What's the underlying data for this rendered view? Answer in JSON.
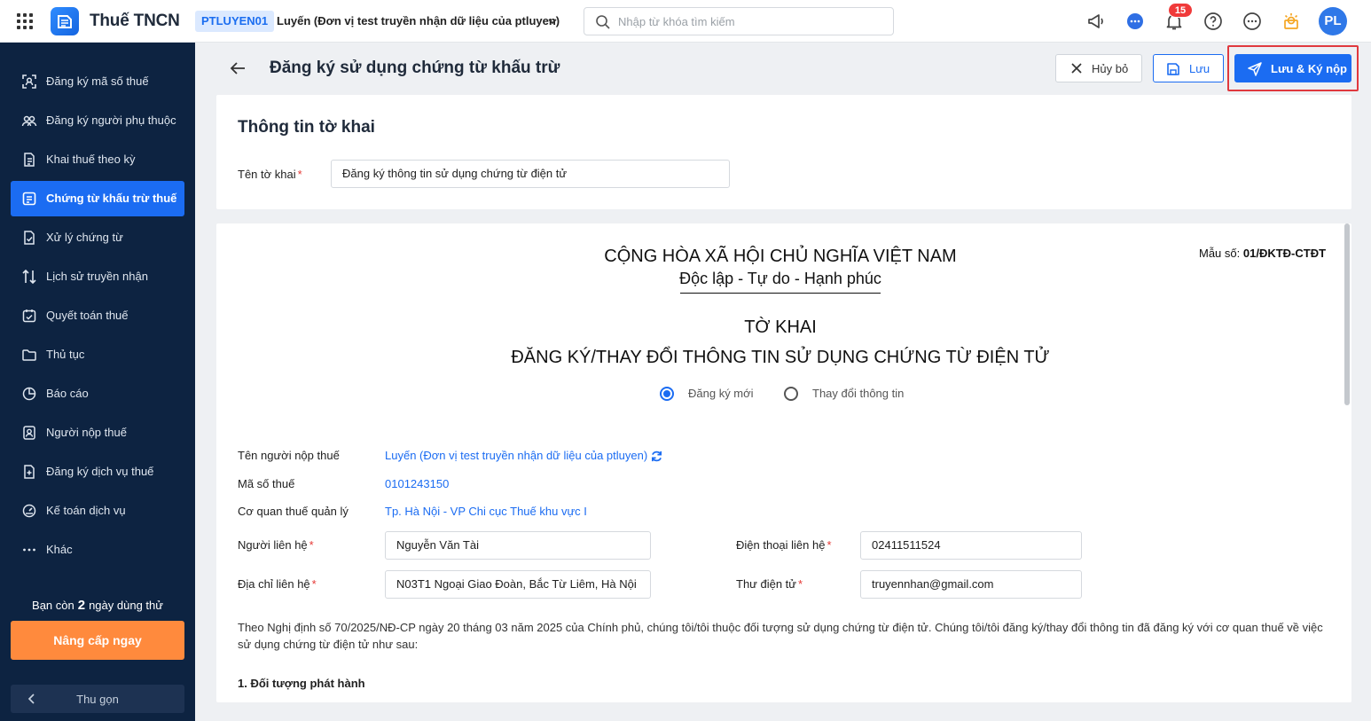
{
  "topbar": {
    "app_name": "Thuế TNCN",
    "unit_code": "PTLUYEN01",
    "unit_name": "Luyến (Đơn vị test truyền nhận dữ liệu của ptluyen)",
    "search_placeholder": "Nhập từ khóa tìm kiếm",
    "notification_count": "15",
    "avatar_initials": "PL"
  },
  "sidebar": {
    "items": [
      {
        "label": "Đăng ký mã số thuế",
        "icon": "scan-user-icon",
        "active": false
      },
      {
        "label": "Đăng ký người phụ thuộc",
        "icon": "users-icon",
        "active": false
      },
      {
        "label": "Khai thuế theo kỳ",
        "icon": "document-icon",
        "active": false
      },
      {
        "label": "Chứng từ khấu trừ thuế",
        "icon": "receipt-icon",
        "active": true
      },
      {
        "label": "Xử lý chứng từ",
        "icon": "document-check-icon",
        "active": false
      },
      {
        "label": "Lịch sử truyền nhận",
        "icon": "transfer-arrows-icon",
        "active": false
      },
      {
        "label": "Quyết toán thuế",
        "icon": "calendar-check-icon",
        "active": false
      },
      {
        "label": "Thủ tục",
        "icon": "folder-icon",
        "active": false
      },
      {
        "label": "Báo cáo",
        "icon": "pie-chart-icon",
        "active": false
      },
      {
        "label": "Người nộp thuế",
        "icon": "user-card-icon",
        "active": false
      },
      {
        "label": "Đăng ký dịch vụ thuế",
        "icon": "document-plus-icon",
        "active": false
      },
      {
        "label": "Kế toán dịch vụ",
        "icon": "gauge-icon",
        "active": false
      },
      {
        "label": "Khác",
        "icon": "more-dots-icon",
        "active": false
      }
    ],
    "trial_prefix": "Bạn còn",
    "trial_days": "2",
    "trial_suffix": "ngày dùng thử",
    "upgrade_label": "Nâng cấp ngay",
    "collapse_label": "Thu gọn"
  },
  "header": {
    "title": "Đăng ký sử dụng chứng từ khấu trừ",
    "cancel_label": "Hủy bỏ",
    "save_label": "Lưu",
    "submit_label": "Lưu & Ký nộp"
  },
  "info": {
    "title": "Thông tin tờ khai",
    "name_label": "Tên tờ khai",
    "name_value": "Đăng ký thông tin sử dụng chứng từ điện tử"
  },
  "form": {
    "country": "CỘNG HÒA XÃ HỘI CHỦ NGHĨA VIỆT NAM",
    "motto": "Độc lập - Tự do - Hạnh phúc",
    "form_no_label": "Mẫu số:",
    "form_no": "01/ĐKTĐ-CTĐT",
    "title1": "TỜ KHAI",
    "title2": "ĐĂNG KÝ/THAY ĐỔI THÔNG TIN SỬ DỤNG CHỨNG TỪ ĐIỆN TỬ",
    "radio_new": "Đăng ký mới",
    "radio_change": "Thay đổi thông tin",
    "taxpayer_label": "Tên người nộp thuế",
    "taxpayer_value": "Luyến (Đơn vị test truyền nhận dữ liệu của ptluyen)",
    "tax_code_label": "Mã số thuế",
    "tax_code_value": "0101243150",
    "authority_label": "Cơ quan thuế quản lý",
    "authority_value": "Tp. Hà Nội - VP Chi cục Thuế khu vực I",
    "contact_label": "Người liên hệ",
    "contact_value": "Nguyễn Văn Tài",
    "phone_label": "Điện thoại liên hệ",
    "phone_value": "02411511524",
    "address_label": "Địa chỉ liên hệ",
    "address_value": "N03T1 Ngoại Giao Đoàn, Bắc Từ Liêm, Hà Nội",
    "email_label": "Thư điện tử",
    "email_value": "truyennhan@gmail.com",
    "paragraph": "Theo Nghị định số 70/2025/NĐ-CP ngày 20 tháng 03 năm 2025 của Chính phủ, chúng tôi/tôi thuộc đối tượng sử dụng chứng từ điện tử. Chúng tôi/tôi đăng ký/thay đổi thông tin đã đăng ký với cơ quan thuế về việc sử dụng chứng từ điện tử như sau:",
    "section1": "1. Đối tượng phát hành"
  },
  "colors": {
    "primary": "#1b6cf2",
    "sidebar_bg": "#0d2341",
    "upgrade": "#ff8a3d",
    "highlight": "#e0393e"
  }
}
